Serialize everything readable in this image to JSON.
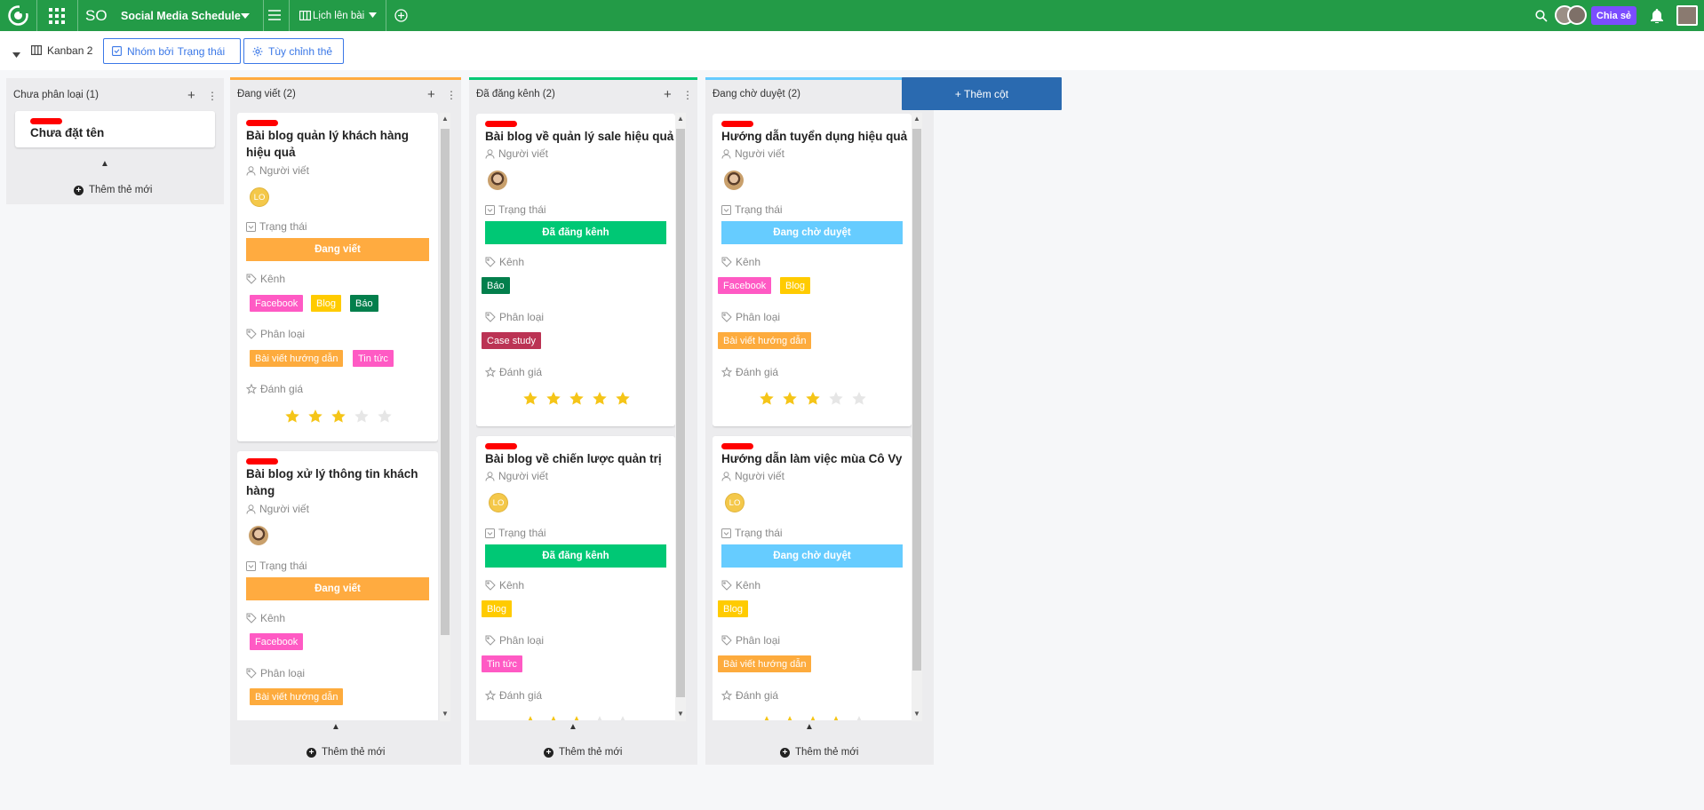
{
  "app": {
    "initials": "SO",
    "title": "Social Media Schedule",
    "view_tab": "Lịch lên bài",
    "share_label": "Chia sẻ"
  },
  "toolbar": {
    "view_name": "Kanban 2",
    "group_by_prefix": "Nhóm bởi",
    "group_by_value": "Trạng thái",
    "customize_label": "Tùy chỉnh thẻ"
  },
  "field_labels": {
    "writer": "Người viết",
    "status": "Trạng thái",
    "channel": "Kênh",
    "category": "Phân loại",
    "rating": "Đánh giá"
  },
  "add_card_label": "Thêm thẻ mới",
  "add_column_label": "+ Thêm cột",
  "colors": {
    "topbar": "#239b47",
    "accent_blue": "#3b78e7",
    "status_writing": "#ffab40",
    "status_published": "#00c875",
    "status_waiting": "#66ccff",
    "tag_facebook": "#ff5ac4",
    "tag_blog": "#ffcb00",
    "tag_bao": "#037f4c",
    "tag_huong_dan": "#fdab3d",
    "tag_tin_tuc": "#ff5ac4",
    "tag_case_study": "#bb3354",
    "star_on": "#f5c518",
    "star_off": "#e6e6e6"
  },
  "columns": [
    {
      "title": "Chưa phân loại (1)",
      "color": "",
      "cards": [
        {
          "title": "Chưa đặt tên"
        }
      ]
    },
    {
      "title": "Đang viết (2)",
      "color": "#ffab40",
      "cards": [
        {
          "title_lines": [
            "Bài blog quản lý khách hàng",
            "hiệu quả"
          ],
          "writer": "LO",
          "status": "Đang viết",
          "channels": [
            "Facebook",
            "Blog",
            "Báo"
          ],
          "categories": [
            "Bài viết hướng dẫn",
            "Tin tức"
          ],
          "rating": 3
        },
        {
          "title_lines": [
            "Bài blog xử lý thông tin khách",
            "hàng"
          ],
          "writer": "photo",
          "status": "Đang viết",
          "channels": [
            "Facebook"
          ],
          "categories": [
            "Bài viết hướng dẫn"
          ],
          "rating": null
        }
      ]
    },
    {
      "title": "Đã đăng kênh (2)",
      "color": "#00c875",
      "cards": [
        {
          "title_lines": [
            "Bài blog về quản lý sale hiệu quả"
          ],
          "writer": "photo",
          "status": "Đã đăng kênh",
          "channels": [
            "Báo"
          ],
          "categories": [
            "Case study"
          ],
          "rating": 5
        },
        {
          "title_lines": [
            "Bài blog về chiến lược quản trị"
          ],
          "writer": "LO",
          "status": "Đã đăng kênh",
          "channels": [
            "Blog"
          ],
          "categories": [
            "Tin tức"
          ],
          "rating": 3
        }
      ]
    },
    {
      "title": "Đang chờ duyệt (2)",
      "color": "#66ccff",
      "cards": [
        {
          "title_lines": [
            "Hướng dẫn tuyển dụng hiệu quả"
          ],
          "writer": "photo",
          "status": "Đang chờ duyệt",
          "channels": [
            "Facebook",
            "Blog"
          ],
          "categories": [
            "Bài viết hướng dẫn"
          ],
          "rating": 3
        },
        {
          "title_lines": [
            "Hướng dẫn làm việc mùa Cô Vy"
          ],
          "writer": "LO",
          "status": "Đang chờ duyệt",
          "channels": [
            "Blog"
          ],
          "categories": [
            "Bài viết hướng dẫn"
          ],
          "rating": 4
        }
      ]
    }
  ]
}
